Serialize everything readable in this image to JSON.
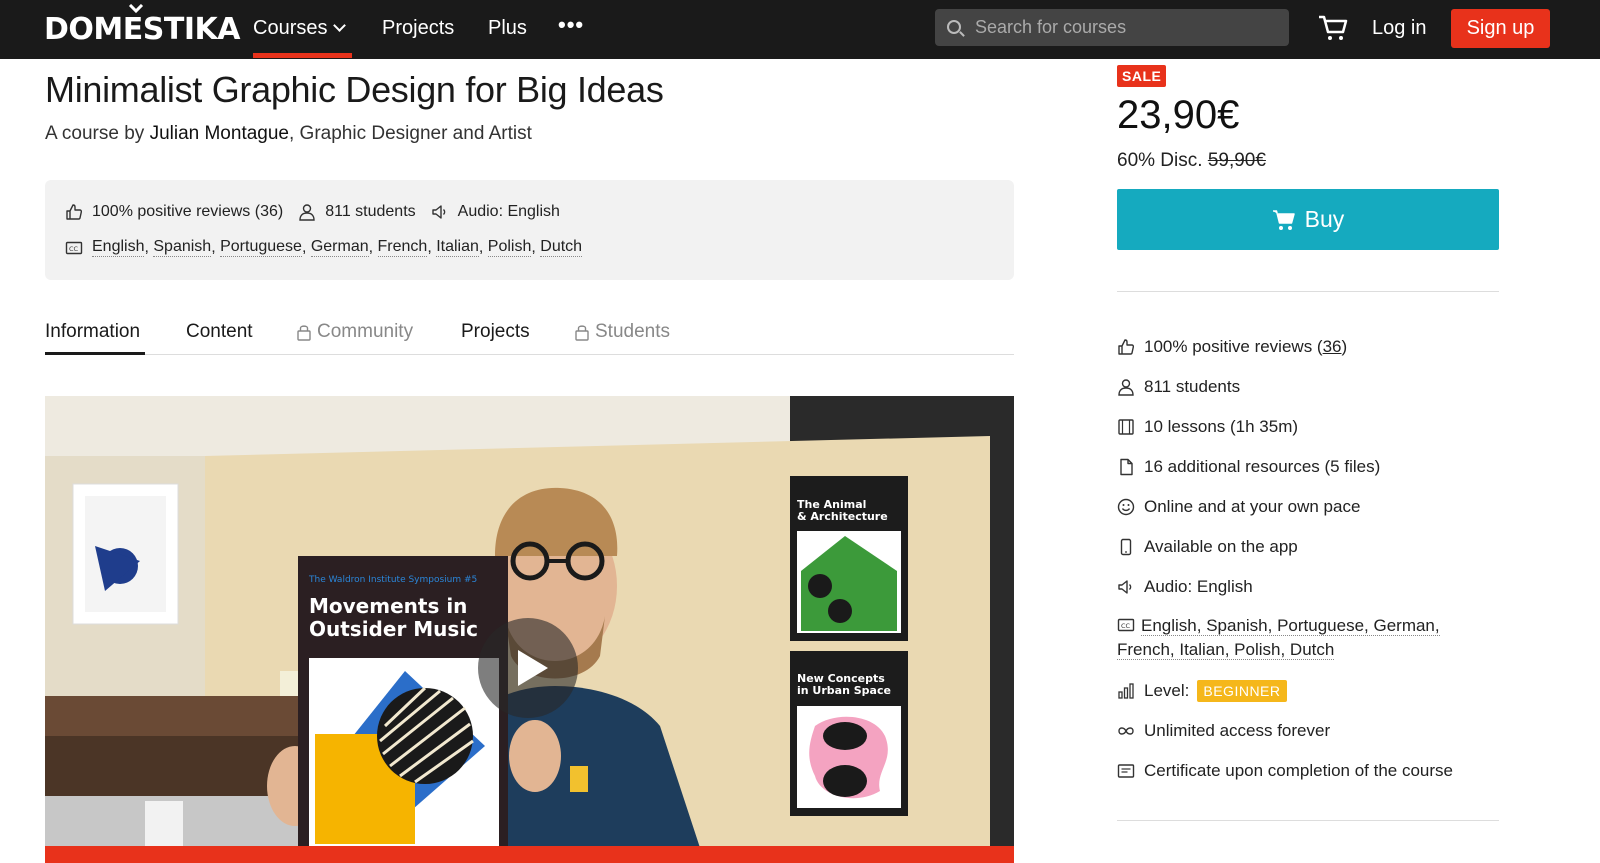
{
  "topbar": {
    "logo": "DOMESTIKA",
    "nav": {
      "courses": "Courses",
      "projects": "Projects",
      "plus": "Plus",
      "more": "•••"
    },
    "search_placeholder": "Search for courses",
    "login": "Log in",
    "signup": "Sign up",
    "accent_color": "#e8321b"
  },
  "course": {
    "title": "Minimalist Graphic Design for Big Ideas",
    "byline_prefix": "A course by",
    "author": "Julian Montague",
    "author_role": ", Graphic Designer and Artist"
  },
  "stats": {
    "reviews": "100% positive reviews (36)",
    "students": "811 students",
    "audio": "Audio: English",
    "subtitles": [
      "English",
      "Spanish",
      "Portuguese",
      "German",
      "French",
      "Italian",
      "Polish",
      "Dutch"
    ]
  },
  "tabs": [
    {
      "label": "Information",
      "locked": false,
      "active": true
    },
    {
      "label": "Content",
      "locked": false,
      "active": false
    },
    {
      "label": "Community",
      "locked": true,
      "active": false
    },
    {
      "label": "Projects",
      "locked": false,
      "active": false
    },
    {
      "label": "Students",
      "locked": true,
      "active": false
    }
  ],
  "video": {
    "poster1_series": "The Waldron Institute Symposium #5",
    "poster1_title_line1": "Movements in",
    "poster1_title_line2": "Outsider Music",
    "poster2_title_line1": "The Animal",
    "poster2_title_line2": "& Architecture",
    "poster3_title_line1": "New Concepts",
    "poster3_title_line2": "in Urban Space"
  },
  "purchase": {
    "sale_badge": "SALE",
    "price": "23,90€",
    "discount_label": "60% Disc.",
    "old_price": "59,90€",
    "buy_label": "Buy",
    "buy_color": "#15aabf"
  },
  "features": {
    "reviews_prefix": "100% positive reviews (",
    "reviews_count": "36",
    "reviews_suffix": ")",
    "students": "811 students",
    "lessons": "10 lessons (1h 35m)",
    "resources": "16 additional resources (5 files)",
    "pace": "Online and at your own pace",
    "app": "Available on the app",
    "audio": "Audio: English",
    "languages_line1": "English, Spanish, Portuguese, German,",
    "languages_line2": "French, Italian, Polish, Dutch",
    "level_label": "Level:",
    "level_value": "BEGINNER",
    "access": "Unlimited access forever",
    "certificate": "Certificate upon completion of the course"
  }
}
